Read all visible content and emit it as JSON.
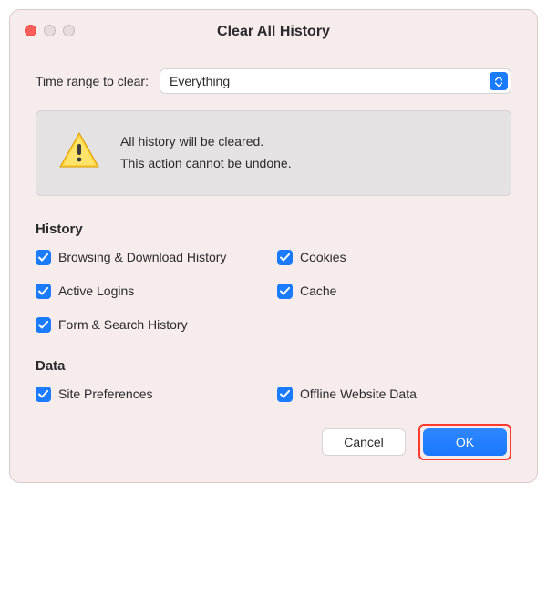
{
  "title": "Clear All History",
  "range": {
    "label": "Time range to clear:",
    "selected": "Everything"
  },
  "warning": {
    "line1": "All history will be cleared.",
    "line2": "This action cannot be undone."
  },
  "sections": {
    "history": {
      "title": "History",
      "items": [
        {
          "label": "Browsing & Download History",
          "checked": true
        },
        {
          "label": "Cookies",
          "checked": true
        },
        {
          "label": "Active Logins",
          "checked": true
        },
        {
          "label": "Cache",
          "checked": true
        },
        {
          "label": "Form & Search History",
          "checked": true
        }
      ]
    },
    "data": {
      "title": "Data",
      "items": [
        {
          "label": "Site Preferences",
          "checked": true
        },
        {
          "label": "Offline Website Data",
          "checked": true
        }
      ]
    }
  },
  "buttons": {
    "cancel": "Cancel",
    "ok": "OK"
  }
}
